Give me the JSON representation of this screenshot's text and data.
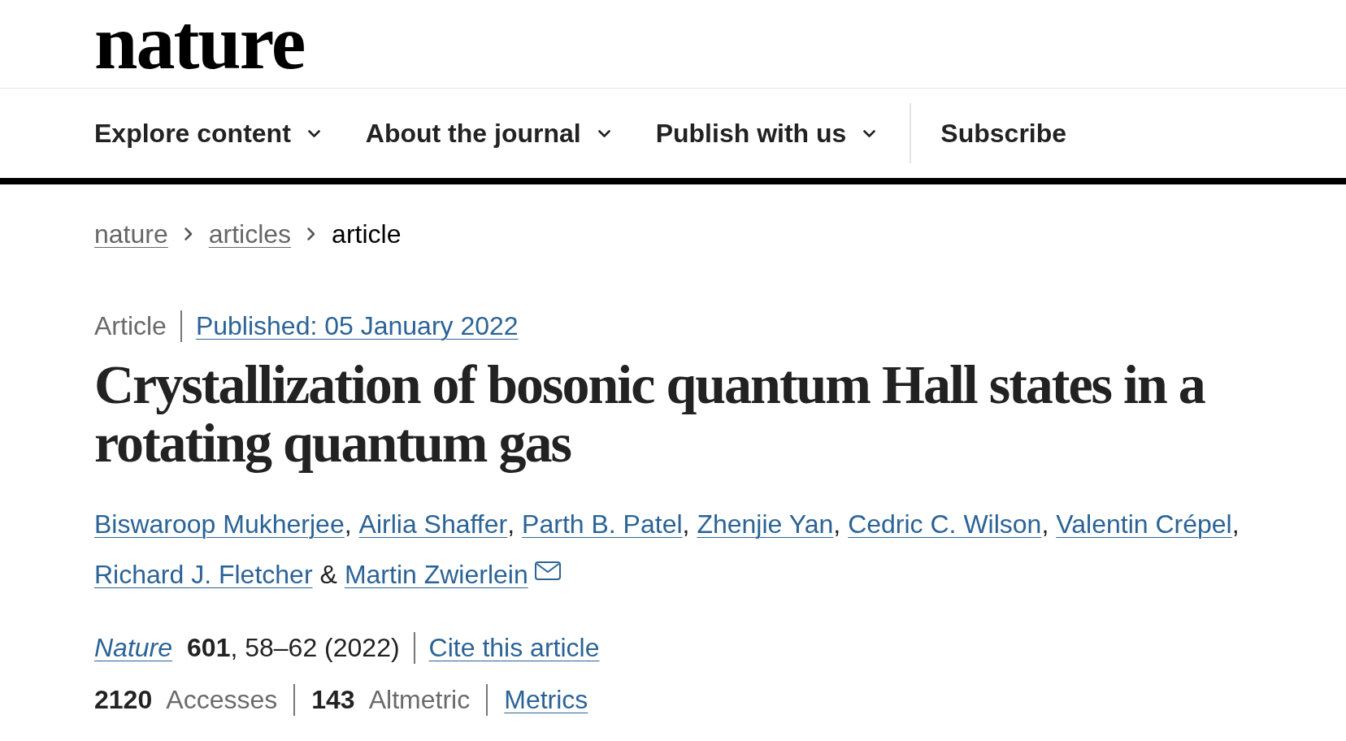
{
  "logo": {
    "text": "nature"
  },
  "nav": {
    "items": [
      {
        "label": "Explore content",
        "kind": "menu"
      },
      {
        "label": "About the journal",
        "kind": "menu"
      },
      {
        "label": "Publish with us",
        "kind": "menu"
      },
      {
        "label": "Subscribe",
        "kind": "link"
      }
    ]
  },
  "breadcrumb": [
    {
      "label": "nature",
      "kind": "link"
    },
    {
      "label": "articles",
      "kind": "link"
    },
    {
      "label": "article",
      "kind": "current"
    }
  ],
  "article_meta": {
    "type": "Article",
    "published": "Published: 05 January 2022"
  },
  "title": "Crystallization of bosonic quantum Hall states in a rotating quantum gas",
  "authors": [
    {
      "name": "Biswaroop Mukherjee",
      "separator": {
        "kind": "comma",
        "text": ","
      },
      "corresponding": false
    },
    {
      "name": "Airlia Shaffer",
      "separator": {
        "kind": "comma",
        "text": ","
      },
      "corresponding": false
    },
    {
      "name": "Parth B. Patel",
      "separator": {
        "kind": "comma",
        "text": ","
      },
      "corresponding": false
    },
    {
      "name": "Zhenjie Yan",
      "separator": {
        "kind": "comma",
        "text": ","
      },
      "corresponding": false
    },
    {
      "name": "Cedric C. Wilson",
      "separator": {
        "kind": "comma",
        "text": ","
      },
      "corresponding": false
    },
    {
      "name": "Valentin Crépel",
      "separator": {
        "kind": "comma",
        "text": ","
      },
      "corresponding": false
    },
    {
      "name": "Richard J. Fletcher",
      "separator": {
        "kind": "and",
        "text": "&"
      },
      "corresponding": false
    },
    {
      "name": "Martin Zwierlein",
      "corresponding": true
    }
  ],
  "citation": {
    "journal": "Nature",
    "reference": "**601**, 58–62 (2022)",
    "cite_link": "Cite this article"
  },
  "metrics": {
    "items": [
      {
        "text": "**2120** Accesses"
      },
      {
        "text": "**143** Altmetric"
      }
    ],
    "link": "Metrics"
  }
}
